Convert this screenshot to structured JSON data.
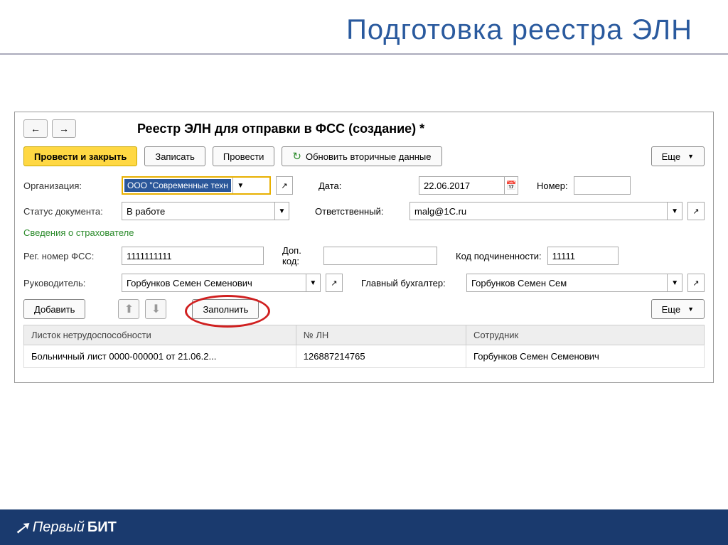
{
  "slide": {
    "title": "Подготовка реестра ЭЛН"
  },
  "window": {
    "title": "Реестр ЭЛН для отправки в ФСС (создание) *"
  },
  "toolbar": {
    "submit": "Провести и закрыть",
    "save": "Записать",
    "post": "Провести",
    "refresh": "Обновить вторичные данные",
    "more": "Еще"
  },
  "form": {
    "org_label": "Организация:",
    "org_value": "ООО \"Современные техн",
    "date_label": "Дата:",
    "date_value": "22.06.2017",
    "number_label": "Номер:",
    "number_value": "",
    "status_label": "Статус документа:",
    "status_value": "В работе",
    "resp_label": "Ответственный:",
    "resp_value": "malg@1C.ru",
    "section": "Сведения о страхователе",
    "regnum_label": "Рег. номер ФСС:",
    "regnum_value": "1111111111",
    "dopcode_label": "Доп. код:",
    "dopcode_value": "",
    "subcode_label": "Код подчиненности:",
    "subcode_value": "11111",
    "head_label": "Руководитель:",
    "head_value": "Горбунков Семен Семенович",
    "accountant_label": "Главный бухгалтер:",
    "accountant_value": "Горбунков Семен Сем"
  },
  "list_toolbar": {
    "add": "Добавить",
    "fill": "Заполнить",
    "more": "Еще"
  },
  "table": {
    "col1": "Листок нетрудоспособности",
    "col2": "№ ЛН",
    "col3": "Сотрудник",
    "row": {
      "doc": "Больничный лист 0000-000001 от 21.06.2...",
      "num": "126887214765",
      "emp": "Горбунков Семен Семенович"
    }
  },
  "footer": {
    "brand1": "Первый",
    "brand2": "БИТ"
  }
}
